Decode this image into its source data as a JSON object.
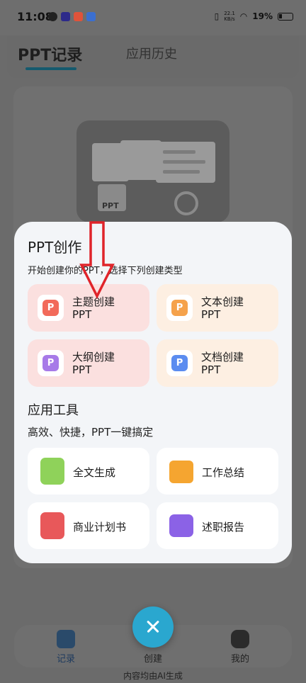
{
  "status_bar": {
    "time": "11:08",
    "net_speed_value": "22.1",
    "net_speed_unit": "KB/s",
    "battery": "19%"
  },
  "background": {
    "tabs": [
      {
        "label": "PPT记录",
        "active": true
      },
      {
        "label": "应用历史",
        "active": false
      }
    ],
    "illustration_label": "PPT"
  },
  "sheet": {
    "creation": {
      "title": "PPT创作",
      "subtitle": "开始创建你的PPT，选择下列创建类型",
      "options": [
        {
          "line1": "主题创建",
          "line2": "PPT",
          "icon": "p-icon",
          "color": "#f26a5a"
        },
        {
          "line1": "文本创建",
          "line2": "PPT",
          "icon": "p-icon",
          "color": "#f5a24b"
        },
        {
          "line1": "大纲创建",
          "line2": "PPT",
          "icon": "p-icon",
          "color": "#a77ae8"
        },
        {
          "line1": "文档创建",
          "line2": "PPT",
          "icon": "p-icon",
          "color": "#5b8cf0"
        }
      ]
    },
    "tools": {
      "title": "应用工具",
      "subtitle": "高效、快捷，PPT一键搞定",
      "items": [
        {
          "label": "全文生成",
          "icon": "document-icon",
          "color": "#8fd25a"
        },
        {
          "label": "工作总结",
          "icon": "briefcase-icon",
          "color": "#f5a530"
        },
        {
          "label": "商业计划书",
          "icon": "book-icon",
          "color": "#e8585a"
        },
        {
          "label": "述职报告",
          "icon": "chart-chat-icon",
          "color": "#8b62e6"
        }
      ]
    }
  },
  "bottom_nav": {
    "items": [
      {
        "label": "记录"
      },
      {
        "label": "创建"
      },
      {
        "label": "我的"
      }
    ]
  },
  "footer_note": "内容均由AI生成"
}
